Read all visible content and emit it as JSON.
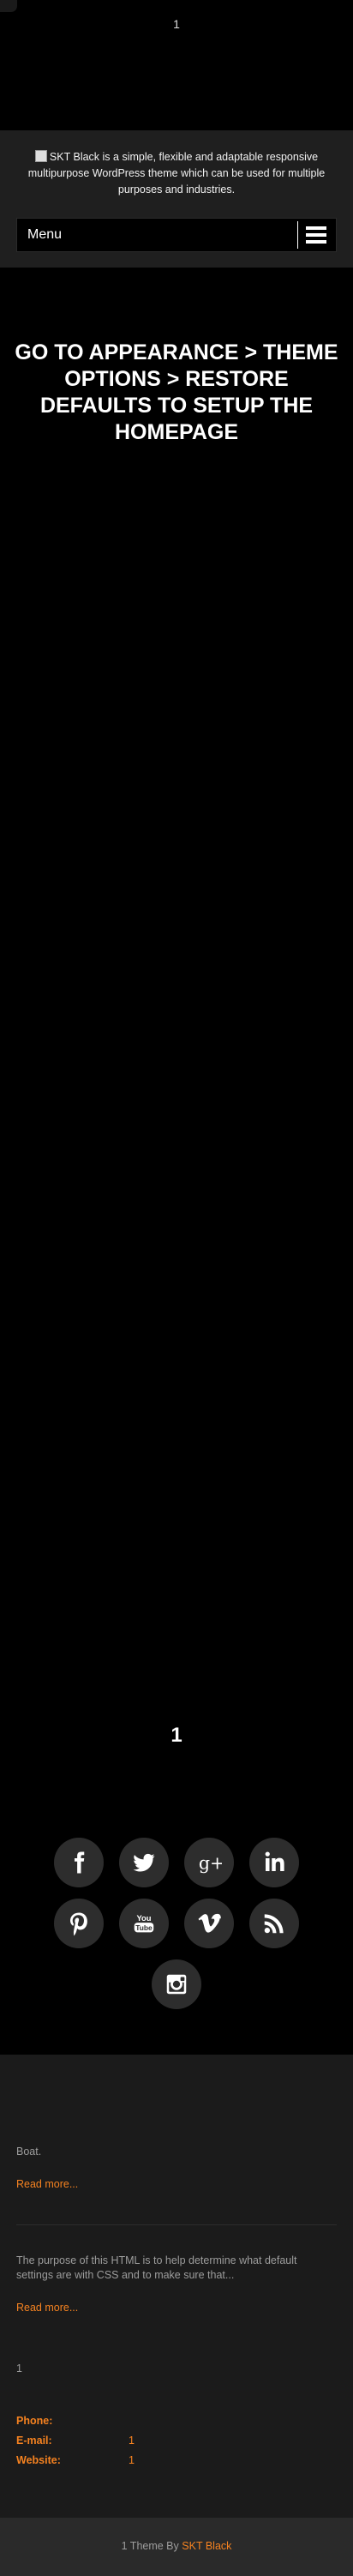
{
  "top": {
    "number": "1"
  },
  "header": {
    "logo_alt": "SKT Black is a simple, flexible and adaptable responsive multipurpose WordPress theme which can be used for multiple purposes and industries."
  },
  "nav": {
    "menu_label": "Menu"
  },
  "hero": {
    "title": "GO TO APPEARANCE > THEME OPTIONS > RESTORE DEFAULTS TO SETUP THE HOMEPAGE"
  },
  "social_section": {
    "number": "1",
    "icons": [
      "facebook-icon",
      "twitter-icon",
      "google-plus-icon",
      "linkedin-icon",
      "pinterest-icon",
      "youtube-icon",
      "vimeo-icon",
      "rss-icon",
      "instagram-icon"
    ]
  },
  "posts": [
    {
      "excerpt": "Boat.",
      "read_more": "Read more..."
    },
    {
      "excerpt": "The purpose of this HTML is to help determine what default settings are with CSS and to make sure that...",
      "read_more": "Read more..."
    }
  ],
  "contact": {
    "number": "1",
    "phone_label": "Phone:",
    "email_label": "E-mail:",
    "email_value": "1",
    "website_label": "Website:",
    "website_value": "1"
  },
  "footer": {
    "prefix": "1 Theme By",
    "link": "SKT Black"
  },
  "colors": {
    "accent": "#f58220",
    "background": "#000000",
    "band": "#1f1f1f"
  }
}
